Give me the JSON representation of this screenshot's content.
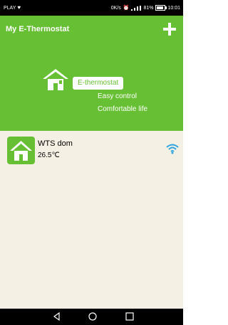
{
  "status": {
    "carrier": "PLAY",
    "speed": "0K/s",
    "battery": "81%",
    "battery_level": 0.81,
    "time": "10:01"
  },
  "header": {
    "title": "My E-Thermostat",
    "brand": "E-thermostat",
    "slogan1": "Easy control",
    "slogan2": "Comfortable life"
  },
  "devices": [
    {
      "name": "WTS dom",
      "temperature": "26.5℃",
      "status_icon": "wifi-icon"
    }
  ],
  "colors": {
    "accent": "#67bf33",
    "background": "#f4f1e4",
    "wifi": "#2ea3df"
  },
  "navigation": {
    "back_icon": "back-triangle-icon",
    "home_icon": "home-circle-icon",
    "recents_icon": "recents-square-icon"
  }
}
